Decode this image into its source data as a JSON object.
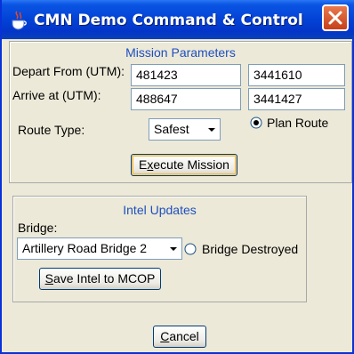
{
  "window": {
    "title": "CMN Demo Command & Control"
  },
  "mission": {
    "title": "Mission Parameters",
    "depart_label": "Depart From (UTM):",
    "depart_easting": "481423",
    "depart_northing": "3441610",
    "arrive_label": "Arrive at (UTM):",
    "arrive_easting": "488647",
    "arrive_northing": "3441427",
    "route_label": "Route Type:",
    "route_value": "Safest",
    "plan_route_label": "Plan Route",
    "plan_route_selected": true,
    "execute_prefix": "E",
    "execute_mnemonic": "x",
    "execute_suffix": "ecute Mission"
  },
  "intel": {
    "title": "Intel Updates",
    "bridge_label": "Bridge:",
    "bridge_value": "Artillery Road Bridge 2",
    "destroyed_label": "Bridge Destroyed",
    "destroyed_selected": false,
    "save_mnemonic": "S",
    "save_suffix": "ave Intel to MCOP"
  },
  "footer": {
    "cancel_mnemonic": "C",
    "cancel_suffix": "ancel"
  },
  "colors": {
    "title_bar": "#0342d6",
    "close": "#c7401a",
    "group_title": "#1f4fbf",
    "background": "#ece9d8"
  }
}
